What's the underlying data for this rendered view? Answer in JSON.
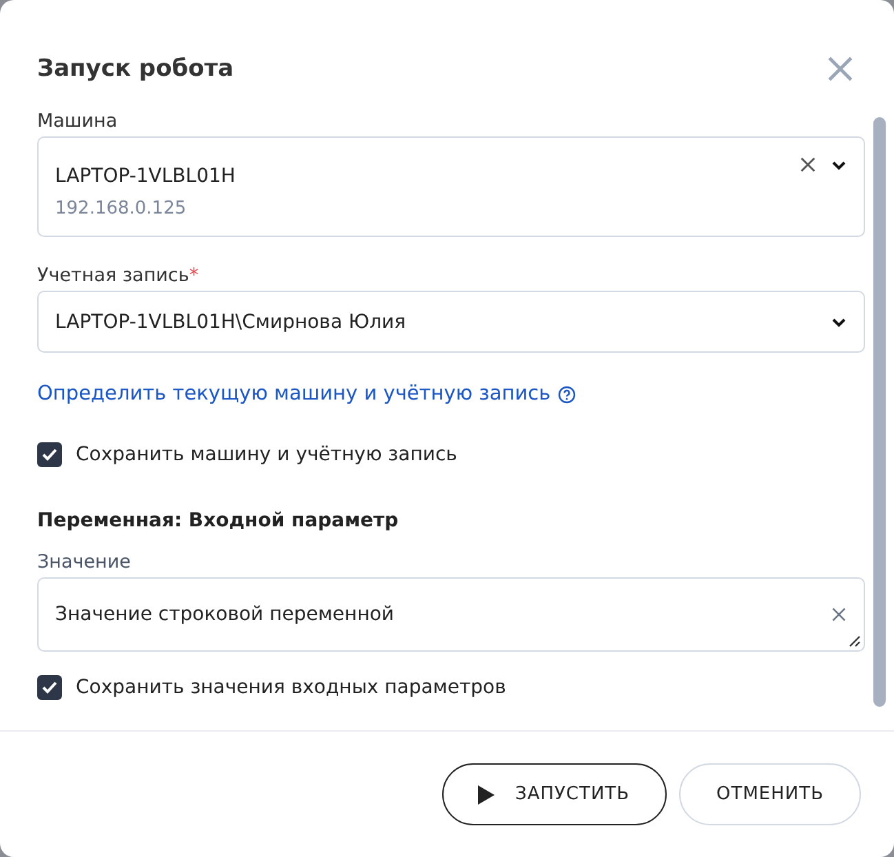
{
  "dialog": {
    "title": "Запуск робота"
  },
  "machine": {
    "label": "Машина",
    "value": "LAPTOP-1VLBL01H",
    "address": "192.168.0.125"
  },
  "account": {
    "label": "Учетная запись",
    "required_mark": "*",
    "value": "LAPTOP-1VLBL01H\\Смирнова Юлия"
  },
  "detect_link": "Определить текущую машину и учётную запись",
  "save_machine": {
    "label": "Сохранить машину и учётную запись",
    "checked": true
  },
  "variable": {
    "heading": "Переменная: Входной параметр",
    "label": "Значение",
    "value": "Значение строковой переменной"
  },
  "save_params": {
    "label": "Сохранить значения входных параметров",
    "checked": true
  },
  "buttons": [
    {
      "label": "ЗАПУСТИТЬ",
      "kind": "primary"
    },
    {
      "label": "ОТМЕНИТЬ",
      "kind": "secondary"
    }
  ]
}
